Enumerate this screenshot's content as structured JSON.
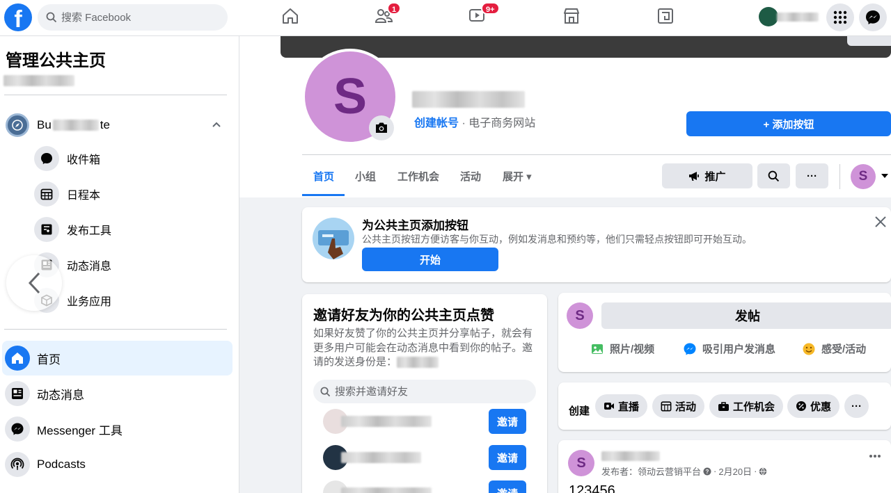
{
  "nav": {
    "logo": "f",
    "search_placeholder": "搜索 Facebook",
    "friends_badge": "1",
    "watch_badge": "9+"
  },
  "sidebar": {
    "title": "管理公共主页",
    "account": {
      "name_prefix": "Bu",
      "name_suffix": "te"
    },
    "subitems": [
      {
        "label": "收件箱",
        "icon": "inbox-icon"
      },
      {
        "label": "日程本",
        "icon": "calendar-icon"
      },
      {
        "label": "发布工具",
        "icon": "publishing-tools-icon"
      },
      {
        "label": "动态消息",
        "icon": "news-feed-icon"
      },
      {
        "label": "业务应用",
        "icon": "business-apps-icon"
      }
    ],
    "main_items": [
      {
        "label": "首页",
        "icon": "home-icon",
        "active": true
      },
      {
        "label": "动态消息",
        "icon": "news-feed-icon"
      },
      {
        "label": "Messenger 工具",
        "icon": "messenger-icon"
      },
      {
        "label": "Podcasts",
        "icon": "podcast-icon"
      }
    ]
  },
  "header": {
    "avatar_letter": "S",
    "create_account_link": "创建帐号",
    "category": " · 电子商务网站",
    "add_button": "+ 添加按钮",
    "tabs": [
      "首页",
      "小组",
      "工作机会",
      "活动",
      "展开 ▾"
    ],
    "promote_button": "推广",
    "more_button": "···",
    "mini_avatar_letter": "S"
  },
  "promo": {
    "title": "为公共主页添加按钮",
    "description": "公共主页按钮方便访客与你互动，例如发消息和预约等，他们只需轻点按钮即可开始互动。",
    "button": "开始"
  },
  "invite": {
    "title": "邀请好友为你的公共主页点赞",
    "description": "如果好友赞了你的公共主页并分享帖子，就会有更多用户可能会在动态消息中看到你的帖子。邀请的发送身份是：",
    "search_placeholder": "搜索并邀请好友",
    "invite_label": "邀请"
  },
  "composer": {
    "avatar_letter": "S",
    "post_button": "发帖",
    "actions": [
      "照片/视频",
      "吸引用户发消息",
      "感受/活动"
    ]
  },
  "create_bar": {
    "label": "创建",
    "pills": [
      "直播",
      "活动",
      "工作机会",
      "优惠"
    ],
    "more": "···"
  },
  "feed": {
    "avatar_letter": "S",
    "publisher_prefix": "发布者：领动云营销平台",
    "date": "2月20日",
    "text": "123456"
  }
}
